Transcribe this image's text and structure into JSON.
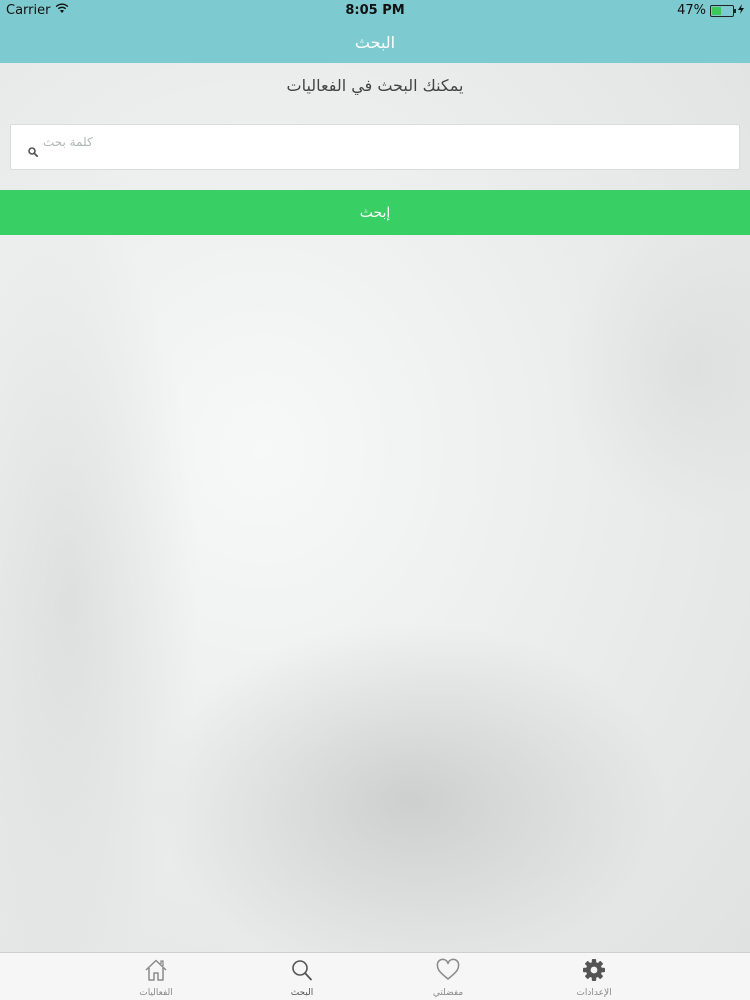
{
  "status_bar": {
    "carrier": "Carrier",
    "time": "8:05 PM",
    "battery": "47%",
    "battery_level": 0.47
  },
  "nav": {
    "title": "البحث"
  },
  "subtitle": "يمكنك البحث في الفعاليات",
  "search": {
    "placeholder": "كلمة بحث",
    "value": ""
  },
  "search_button": {
    "label": "إبحث"
  },
  "tabs": [
    {
      "label": "الفعاليات",
      "icon": "home-icon"
    },
    {
      "label": "البحث",
      "icon": "search-icon"
    },
    {
      "label": "مفضلتي",
      "icon": "heart-icon"
    },
    {
      "label": "الإعدادات",
      "icon": "gear-icon"
    }
  ],
  "colors": {
    "nav_bar": "#7dcbd0",
    "accent_green": "#38cf64"
  }
}
